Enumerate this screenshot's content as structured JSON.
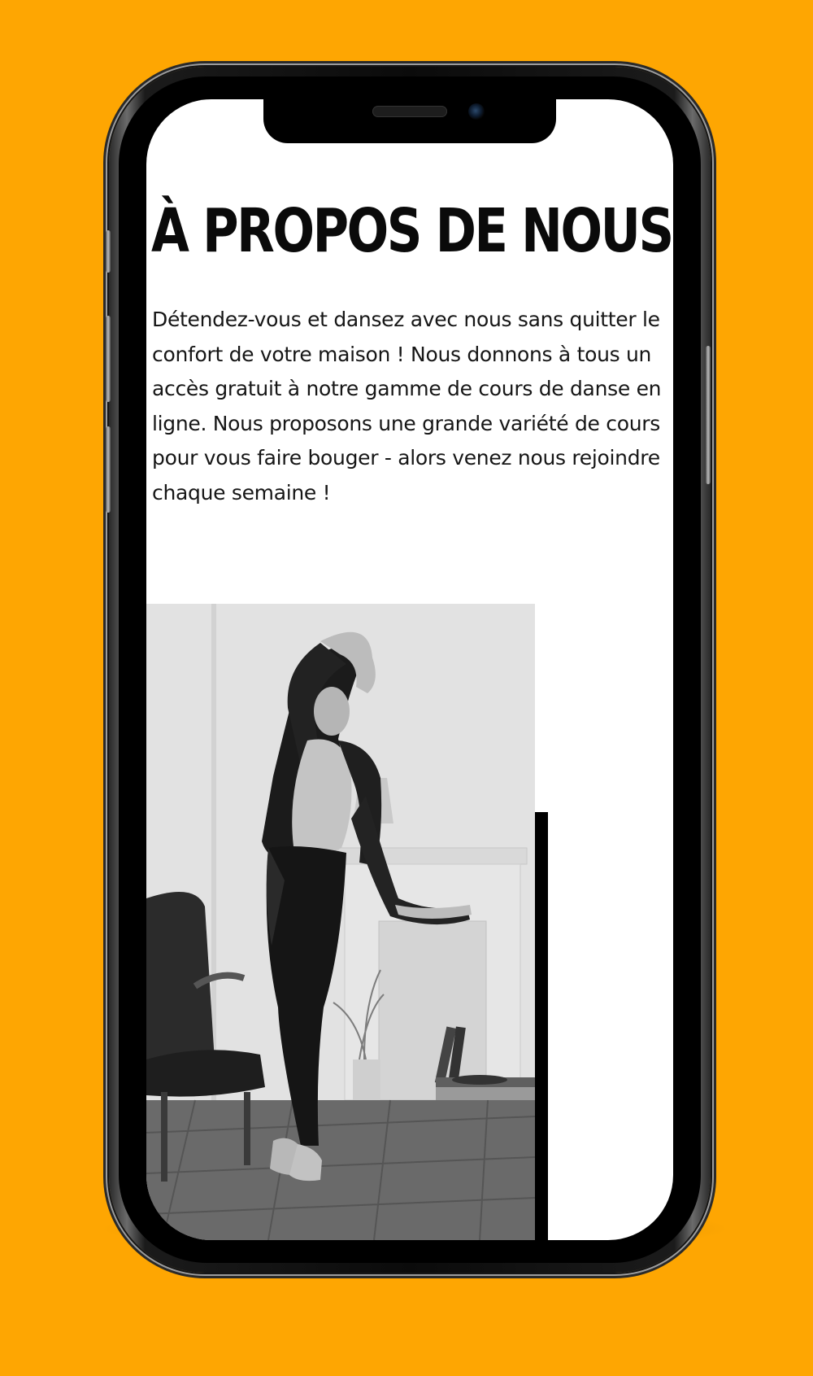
{
  "colors": {
    "background": "#FEA602",
    "phone_frame": "#0b0b0b",
    "screen": "#ffffff",
    "text": "#161616",
    "accent_bar": "#000000"
  },
  "about": {
    "title": "À PROPOS DE NOUS",
    "body": "Détendez-vous et dansez avec nous sans quitter le confort de votre maison ! Nous donnons à tous un accès gratuit à notre gamme de cours de danse en ligne. Nous proposons une grande variété de cours pour vous faire bouger - alors venez nous rejoindre chaque semaine !"
  },
  "photo": {
    "icon": "dancer-photo",
    "style": "black-and-white"
  }
}
